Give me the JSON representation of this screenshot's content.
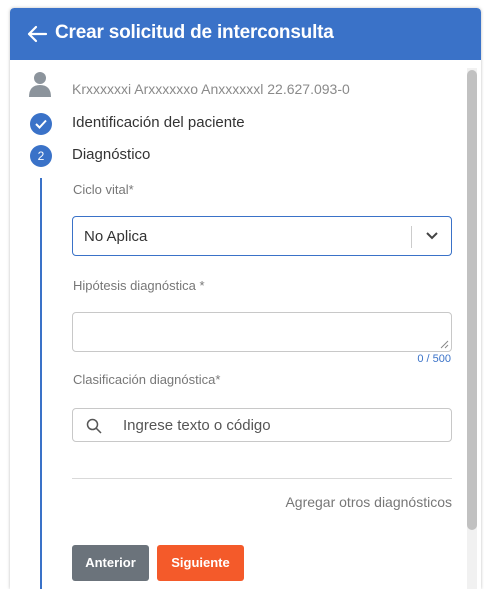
{
  "header": {
    "title": "Crear solicitud de interconsulta",
    "back_icon": "arrow-left-icon"
  },
  "patient": {
    "name_id": "Krxxxxxxi Arxxxxxxo Anxxxxxxl  22.627.093-0",
    "icon": "person-icon"
  },
  "steps": [
    {
      "marker": "check",
      "label": "Identificación del paciente"
    },
    {
      "marker": "2",
      "label": "Diagnóstico"
    }
  ],
  "form": {
    "ciclo_vital": {
      "label": "Ciclo vital*",
      "value": "No Aplica"
    },
    "hipotesis": {
      "label": "Hipótesis diagnóstica *",
      "value": "",
      "counter": "0 / 500"
    },
    "clasificacion": {
      "label": "Clasificación diagnóstica*",
      "placeholder": "Ingrese texto o código"
    },
    "add_link": "Agregar otros diagnósticos"
  },
  "actions": {
    "previous": "Anterior",
    "next": "Siguiente"
  },
  "colors": {
    "primary": "#3a72c8",
    "next_button": "#f45a2a",
    "prev_button": "#6b737b"
  }
}
